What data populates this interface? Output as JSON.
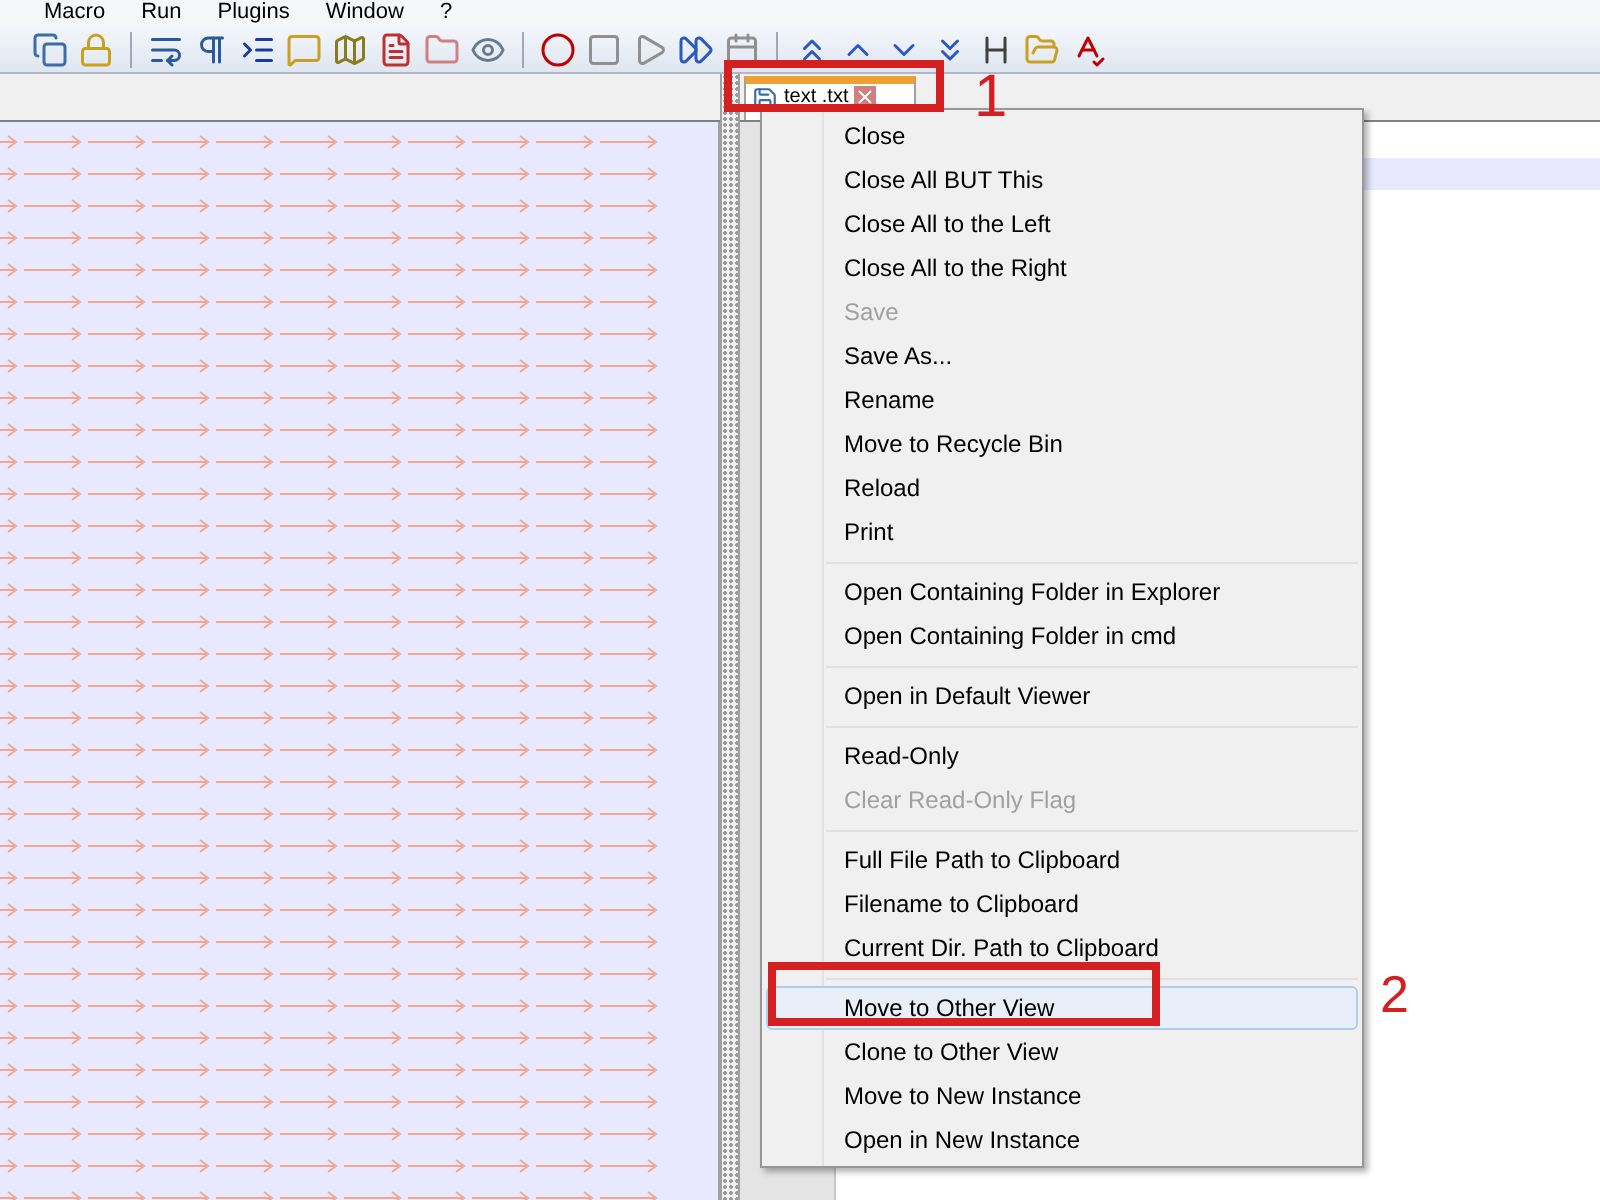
{
  "menu_bar": [
    "Macro",
    "Run",
    "Plugins",
    "Window",
    "?"
  ],
  "tab": {
    "title": "text .txt",
    "selected": true
  },
  "context_menu": [
    {
      "kind": "item",
      "label": "Close",
      "disabled": false,
      "selected": false
    },
    {
      "kind": "item",
      "label": "Close All BUT This",
      "disabled": false,
      "selected": false
    },
    {
      "kind": "item",
      "label": "Close All to the Left",
      "disabled": false,
      "selected": false
    },
    {
      "kind": "item",
      "label": "Close All to the Right",
      "disabled": false,
      "selected": false
    },
    {
      "kind": "item",
      "label": "Save",
      "disabled": true,
      "selected": false
    },
    {
      "kind": "item",
      "label": "Save As...",
      "disabled": false,
      "selected": false
    },
    {
      "kind": "item",
      "label": "Rename",
      "disabled": false,
      "selected": false
    },
    {
      "kind": "item",
      "label": "Move to Recycle Bin",
      "disabled": false,
      "selected": false
    },
    {
      "kind": "item",
      "label": "Reload",
      "disabled": false,
      "selected": false
    },
    {
      "kind": "item",
      "label": "Print",
      "disabled": false,
      "selected": false
    },
    {
      "kind": "separator"
    },
    {
      "kind": "item",
      "label": "Open Containing Folder in Explorer",
      "disabled": false,
      "selected": false
    },
    {
      "kind": "item",
      "label": "Open Containing Folder in cmd",
      "disabled": false,
      "selected": false
    },
    {
      "kind": "separator"
    },
    {
      "kind": "item",
      "label": "Open in Default Viewer",
      "disabled": false,
      "selected": false
    },
    {
      "kind": "separator"
    },
    {
      "kind": "item",
      "label": "Read-Only",
      "disabled": false,
      "selected": false
    },
    {
      "kind": "item",
      "label": "Clear Read-Only Flag",
      "disabled": true,
      "selected": false
    },
    {
      "kind": "separator"
    },
    {
      "kind": "item",
      "label": "Full File Path to Clipboard",
      "disabled": false,
      "selected": false
    },
    {
      "kind": "item",
      "label": "Filename to Clipboard",
      "disabled": false,
      "selected": false
    },
    {
      "kind": "item",
      "label": "Current Dir. Path to Clipboard",
      "disabled": false,
      "selected": false
    },
    {
      "kind": "separator"
    },
    {
      "kind": "item",
      "label": "Move to Other View",
      "disabled": false,
      "selected": true
    },
    {
      "kind": "item",
      "label": "Clone to Other View",
      "disabled": false,
      "selected": false
    },
    {
      "kind": "item",
      "label": "Move to New Instance",
      "disabled": false,
      "selected": false
    },
    {
      "kind": "item",
      "label": "Open in New Instance",
      "disabled": false,
      "selected": false
    }
  ],
  "annotations": [
    {
      "label": "1"
    },
    {
      "label": "2"
    }
  ]
}
